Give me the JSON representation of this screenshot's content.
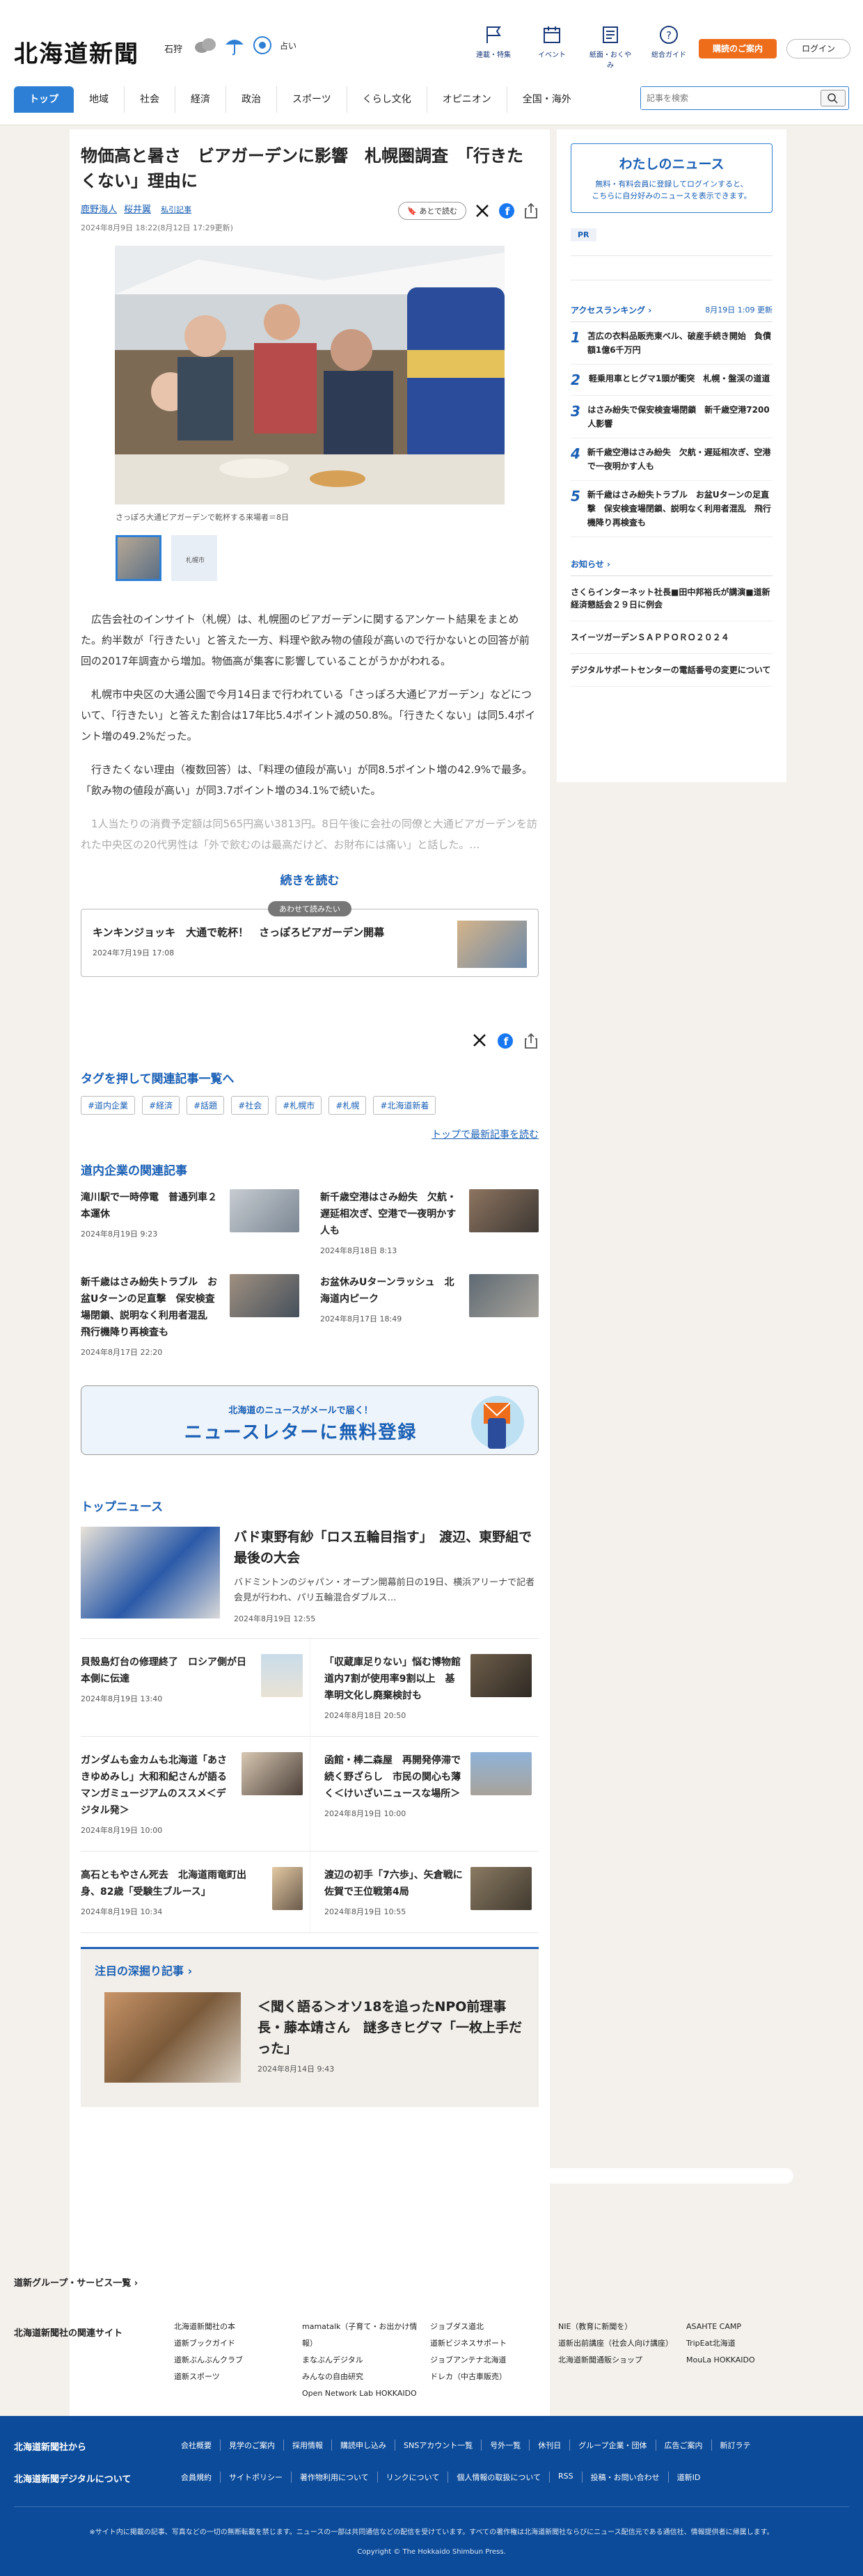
{
  "header": {
    "logo": "北海道新聞",
    "city": "石狩",
    "weather_text": "占い",
    "nav": [
      "連載・特集",
      "イベント",
      "紙面・おくやみ",
      "総合ガイド"
    ],
    "subscribe_label": "購読のご案内",
    "login_label": "ログイン"
  },
  "gnav": [
    "トップ",
    "地域",
    "社会",
    "経済",
    "政治",
    "スポーツ",
    "くらし文化",
    "オピニオン",
    "全国・海外"
  ],
  "search": {
    "placeholder": "記事を検索"
  },
  "article": {
    "title": "物価高と暑さ　ビアガーデンに影響　札幌圏調査　「行きたくない」理由に",
    "authors": [
      "鹿野海人",
      "桜井翼"
    ],
    "related_link": "私引記事",
    "date": "2024年8月9日 18:22(8月12日 17:29更新)",
    "later_label": "あとで読む",
    "caption": "さっぽろ大通ビアガーデンで乾杯する来場者＝8日",
    "thumb_label": "札幌市",
    "paragraphs": [
      "広告会社のインサイト（札幌）は、札幌圏のビアガーデンに関するアンケート結果をまとめた。約半数が「行きたい」と答えた一方、料理や飲み物の値段が高いので行かないとの回答が前回の2017年調査から増加。物価高が集客に影響していることがうかがわれる。",
      "札幌市中央区の大通公園で今月14日まで行われている「さっぽろ大通ビアガーデン」などについて、「行きたい」と答えた割合は17年比5.4ポイント減の50.8%。「行きたくない」は同5.4ポイント増の49.2%だった。",
      "行きたくない理由（複数回答）は、「料理の値段が高い」が同8.5ポイント増の42.9%で最多。「飲み物の値段が高い」が同3.7ポイント増の34.1%で続いた。",
      "1人当たりの消費予定額は同565円高い3813円。8日午後に会社の同僚と大通ビアガーデンを訪れた中央区の20代男性は「外で飲むのは最高だけど、お財布には痛い」と話した。…"
    ],
    "read_more": "続きを読む"
  },
  "recommend": {
    "label": "あわせて読みたい",
    "title": "キンキンジョッキ　大通で乾杯！　さっぽろビアガーデン開幕",
    "date": "2024年7月19日 17:08"
  },
  "tags": {
    "heading": "タグを押して関連記事一覧へ",
    "items": [
      "#道内企業",
      "#経済",
      "#話題",
      "#社会",
      "#札幌市",
      "#札幌",
      "#北海道新着"
    ],
    "top_link": "トップで最新記事を読む"
  },
  "related": {
    "heading": "道内企業の関連記事",
    "items": [
      {
        "title": "滝川駅で一時停電　普通列車２本運休",
        "date": "2024年8月19日 9:23"
      },
      {
        "title": "新千歳空港はさみ紛失　欠航・遅延相次ぎ、空港で一夜明かす人も",
        "date": "2024年8月18日 8:13"
      },
      {
        "title": "新千歳はさみ紛失トラブル　お盆Uターンの足直撃　保安検査場閉鎖、説明なく利用者混乱　飛行機降り再検査も",
        "date": "2024年8月17日 22:20"
      },
      {
        "title": "お盆休みUターンラッシュ　北海道内ピーク",
        "date": "2024年8月17日 18:49"
      }
    ]
  },
  "newsletter": {
    "line1": "北海道のニュースがメールで届く！",
    "line2": "ニュースレターに無料登録"
  },
  "topnews": {
    "heading": "トップニュース",
    "lead": {
      "title": "バド東野有紗「ロス五輪目指す」　渡辺、東野組で最後の大会",
      "text": "バドミントンのジャパン・オープン開幕前日の19日、横浜アリーナで記者会見が行われ、パリ五輪混合ダブルス…",
      "date": "2024年8月19日 12:55"
    },
    "items": [
      {
        "title": "貝殻島灯台の修理終了　ロシア側が日本側に伝達",
        "date": "2024年8月19日 13:40"
      },
      {
        "title": "「収蔵庫足りない」悩む博物館　道内7割が使用率9割以上　基準明文化し廃棄検討も",
        "date": "2024年8月18日 20:50"
      },
      {
        "title": "ガンダムも金カムも北海道「あさきゆめみし」大和和紀さんが語るマンガミュージアムのススメ＜デジタル発＞",
        "date": "2024年8月19日 10:00"
      },
      {
        "title": "函館・棒二森屋　再開発停滞で続く野ざらし　市民の関心も薄く＜けいざいニュースな場所＞",
        "date": "2024年8月19日 10:00"
      },
      {
        "title": "高石ともやさん死去　北海道雨竜町出身、82歳「受験生ブルース」",
        "date": "2024年8月19日 10:34"
      },
      {
        "title": "渡辺の初手「7六歩」、矢倉戦に　佐賀で王位戦第4局",
        "date": "2024年8月19日 10:55"
      }
    ]
  },
  "deep": {
    "heading": "注目の深掘り記事",
    "title": "＜聞く語る＞オソ18を追ったNPO前理事長・藤本靖さん　謎多きヒグマ「一枚上手だった」",
    "date": "2024年8月14日 9:43"
  },
  "sidebar": {
    "my_news_title": "わたしのニュース",
    "my_news_text1": "無料・有料会員に登録してログインすると、",
    "my_news_text2": "こちらに自分好みのニュースを表示できます。",
    "pr": "PR",
    "ranking_title": "アクセスランキング",
    "ranking_updated": "8月19日 1:09 更新",
    "ranking": [
      "苫広の衣料品販売東ベル、破産手続き開始　負債額1億6千万円",
      "軽乗用車とヒグマ1頭が衝突　札幌・盤渓の道道",
      "はさみ紛失で保安検査場閉鎖　新千歳空港7200人影響",
      "新千歳空港はさみ紛失　欠航・遅延相次ぎ、空港で一夜明かす人も",
      "新千歳はさみ紛失トラブル　お盆Uターンの足直撃　保安検査場閉鎖、説明なく利用者混乱　飛行機降り再検査も"
    ],
    "notice_title": "お知らせ",
    "notices": [
      "さくらインターネット社長■田中邦裕氏が講演■道新経済懇話会２９日に例会",
      "スイーツガーデンＳＡＰＰＯＲＯ２０２４",
      "デジタルサポートセンターの電話番号の変更について"
    ]
  },
  "footer": {
    "group": "道新グループ・サービス一覧",
    "related_sites": "北海道新聞社の関連サイト",
    "sites": [
      [
        "北海道新聞社の本",
        "道新ブックガイド",
        "道新ぶんぶんクラブ",
        "道新スポーツ"
      ],
      [
        "mamatalk（子育て・お出かけ情報）",
        "まなぶんデジタル",
        "みんなの自由研究",
        "Open Network Lab HOKKAIDO"
      ],
      [
        "ジョブダス道北",
        "道新ビジネスサポート",
        "ジョブアンテナ北海道",
        "ドレカ（中古車販売）"
      ],
      [
        "NIE（教育に新聞を）",
        "道新出前講座（社会人向け講座）",
        "北海道新聞通販ショップ"
      ],
      [
        "ASAHTE CAMP",
        "TripEat北海道",
        "MouLa HOKKAIDO"
      ]
    ],
    "from": "北海道新聞社から",
    "digital": "北海道新聞デジタルについて",
    "links1": [
      "会社概要",
      "見学のご案内",
      "採用情報",
      "購読申し込み",
      "SNSアカウント一覧",
      "号外一覧",
      "休刊日",
      "グループ企業・団体",
      "広告ご案内",
      "新訂ラテ"
    ],
    "links2": [
      "会員規約",
      "サイトポリシー",
      "著作物利用について",
      "リンクについて",
      "個人情報の取扱について",
      "RSS",
      "投稿・お問い合わせ",
      "道新ID"
    ],
    "note": "※サイト内に掲載の記事、写真などの一切の無断転載を禁じます。ニュースの一部は共同通信などの配信を受けています。すべての著作権は北海道新聞社ならびにニュース配信元である通信社、情報提供者に帰属します。",
    "copyright": "Copyright © The Hokkaido Shimbun Press."
  }
}
